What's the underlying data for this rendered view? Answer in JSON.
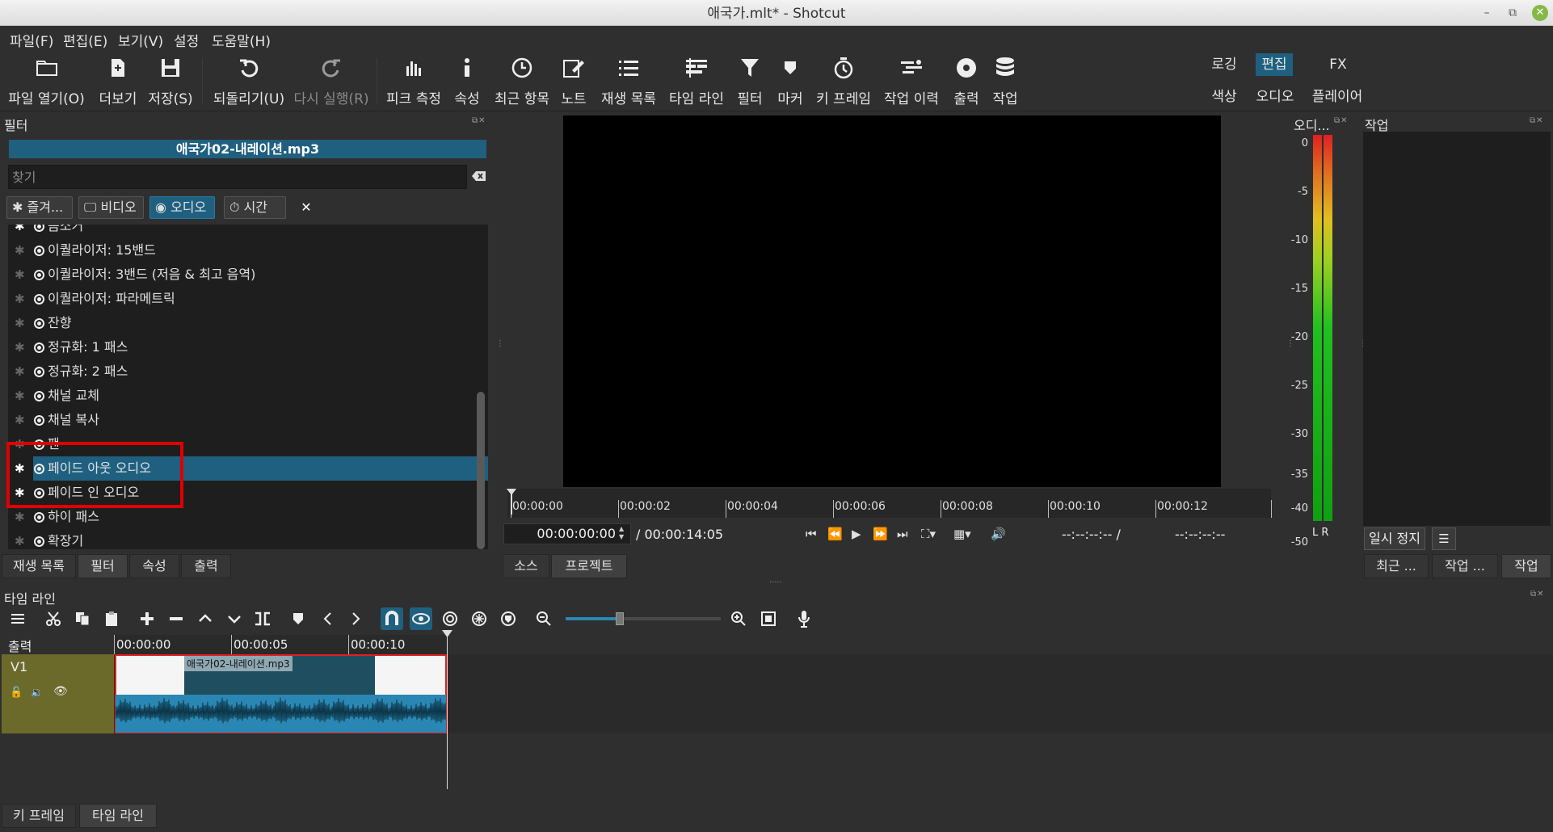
{
  "window": {
    "title": "애국가.mlt* - Shotcut",
    "min": "–",
    "max": "⧉",
    "close": "✕"
  },
  "menu": [
    "파일(F)",
    "편집(E)",
    "보기(V)",
    "설정",
    "도움말(H)"
  ],
  "toolbar": {
    "open": "파일 열기(O)",
    "more": "더보기",
    "save": "저장(S)",
    "undo": "되돌리기(U)",
    "redo": "다시 실행(R)",
    "peak": "피크 측정",
    "props": "속성",
    "recent": "최근 항목",
    "notes": "노트",
    "playlist": "재생 목록",
    "timeline": "타임 라인",
    "filters": "필터",
    "markers": "마커",
    "keyframes": "키 프레임",
    "history": "작업 이력",
    "export": "출력",
    "jobs": "작업"
  },
  "layouts": {
    "logging": "로깅",
    "editing": "편집",
    "fx": "FX",
    "color": "색상",
    "audio": "오디오",
    "player": "플레이어"
  },
  "filter_panel": {
    "title": "필터",
    "clip_name": "애국가02-내레이션.mp3",
    "search_placeholder": "찾기",
    "buttons": {
      "fav": "즐겨...",
      "video": "비디오",
      "audio": "오디오",
      "time": "시간"
    },
    "items": [
      {
        "label": "음소거",
        "fav": true
      },
      {
        "label": "이퀄라이저: 15밴드",
        "fav": false
      },
      {
        "label": "이퀄라이저: 3밴드 (저음 & 최고 음역)",
        "fav": false
      },
      {
        "label": "이퀄라이저: 파라메트릭",
        "fav": false
      },
      {
        "label": "잔향",
        "fav": false
      },
      {
        "label": "정규화: 1 패스",
        "fav": false
      },
      {
        "label": "정규화: 2 패스",
        "fav": false
      },
      {
        "label": "채널 교체",
        "fav": false
      },
      {
        "label": "채널 복사",
        "fav": false
      },
      {
        "label": "팬",
        "fav": false
      },
      {
        "label": "페이드 아웃 오디오",
        "fav": true,
        "selected": true
      },
      {
        "label": "페이드 인 오디오",
        "fav": true
      },
      {
        "label": "하이 패스",
        "fav": false
      },
      {
        "label": "확장기",
        "fav": false
      }
    ],
    "tabs": [
      "재생 목록",
      "필터",
      "속성",
      "출력"
    ]
  },
  "player": {
    "ruler": [
      "00:00:00",
      "00:00:02",
      "00:00:04",
      "00:00:06",
      "00:00:08",
      "00:00:10",
      "00:00:12"
    ],
    "position": "00:00:00:00",
    "duration": "/ 00:00:14:05",
    "in_point": "--:--:--:-- /",
    "out_point": "--:--:--:--",
    "tabs": [
      "소스",
      "프로젝트"
    ]
  },
  "meter": {
    "title": "오디...",
    "scale": [
      "0",
      "-5",
      "-10",
      "-15",
      "-20",
      "-25",
      "-30",
      "-35",
      "-40",
      "-50"
    ],
    "lr": "L R"
  },
  "jobs": {
    "title": "작업",
    "pause": "일시 정지",
    "menu": "☰",
    "tabs": [
      "최근 ...",
      "작업 ...",
      "작업"
    ]
  },
  "timeline": {
    "title": "타임 라인",
    "output_label": "출력",
    "track": "V1",
    "ruler": [
      "00:00:00",
      "00:00:05",
      "00:00:10"
    ],
    "clip_label": "애국가02-내레이션.mp3",
    "zoom_fraction": 0.35
  },
  "bottom_tabs": [
    "키 프레임",
    "타임 라인"
  ],
  "colors": {
    "accent": "#1f6080",
    "highlight": "#e00000",
    "track": "#6b6a2a",
    "waveform": "#2a87b3"
  }
}
